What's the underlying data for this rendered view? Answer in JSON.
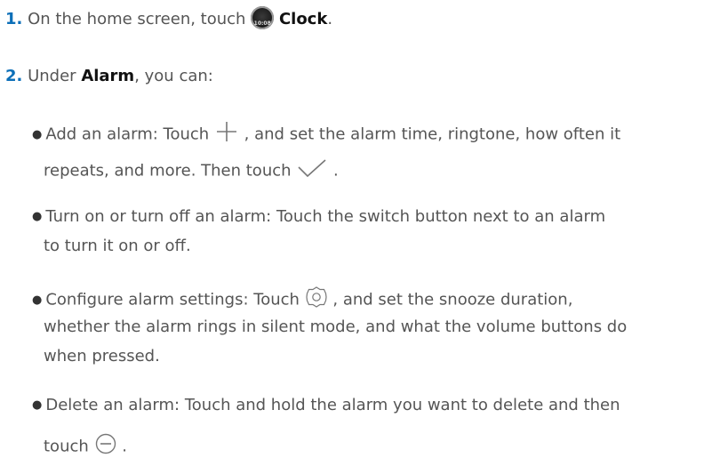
{
  "steps": [
    {
      "number": "1.",
      "before": " On the home screen, touch ",
      "app_icon_text": "10:08",
      "app_name": "Clock",
      "after": "."
    },
    {
      "number": "2.",
      "before": " Under ",
      "keyword": "Alarm",
      "after": ", you can:"
    }
  ],
  "bullets": {
    "add": {
      "line1_before": "Add an alarm: Touch ",
      "line1_after": " , and set the alarm time, ringtone, how often it",
      "line2_before": "repeats, and more. Then touch ",
      "line2_after": " ."
    },
    "toggle": {
      "line1": "Turn on or turn off an alarm: Touch the switch button next to an alarm",
      "line2": "to turn it on or off."
    },
    "settings": {
      "line1_before": "Configure alarm settings: Touch ",
      "line1_after": " , and set the snooze duration,",
      "line2": "whether the alarm rings in silent mode, and what the volume buttons do",
      "line3": "when pressed."
    },
    "delete": {
      "line1": "Delete an alarm: Touch and hold the alarm you want to delete and then",
      "line2_before": "touch ",
      "line2_after": " ."
    }
  },
  "icons": {
    "bullet_glyph": "●",
    "icon_color": "#777777",
    "accent_number_color": "#0c6fb8"
  }
}
